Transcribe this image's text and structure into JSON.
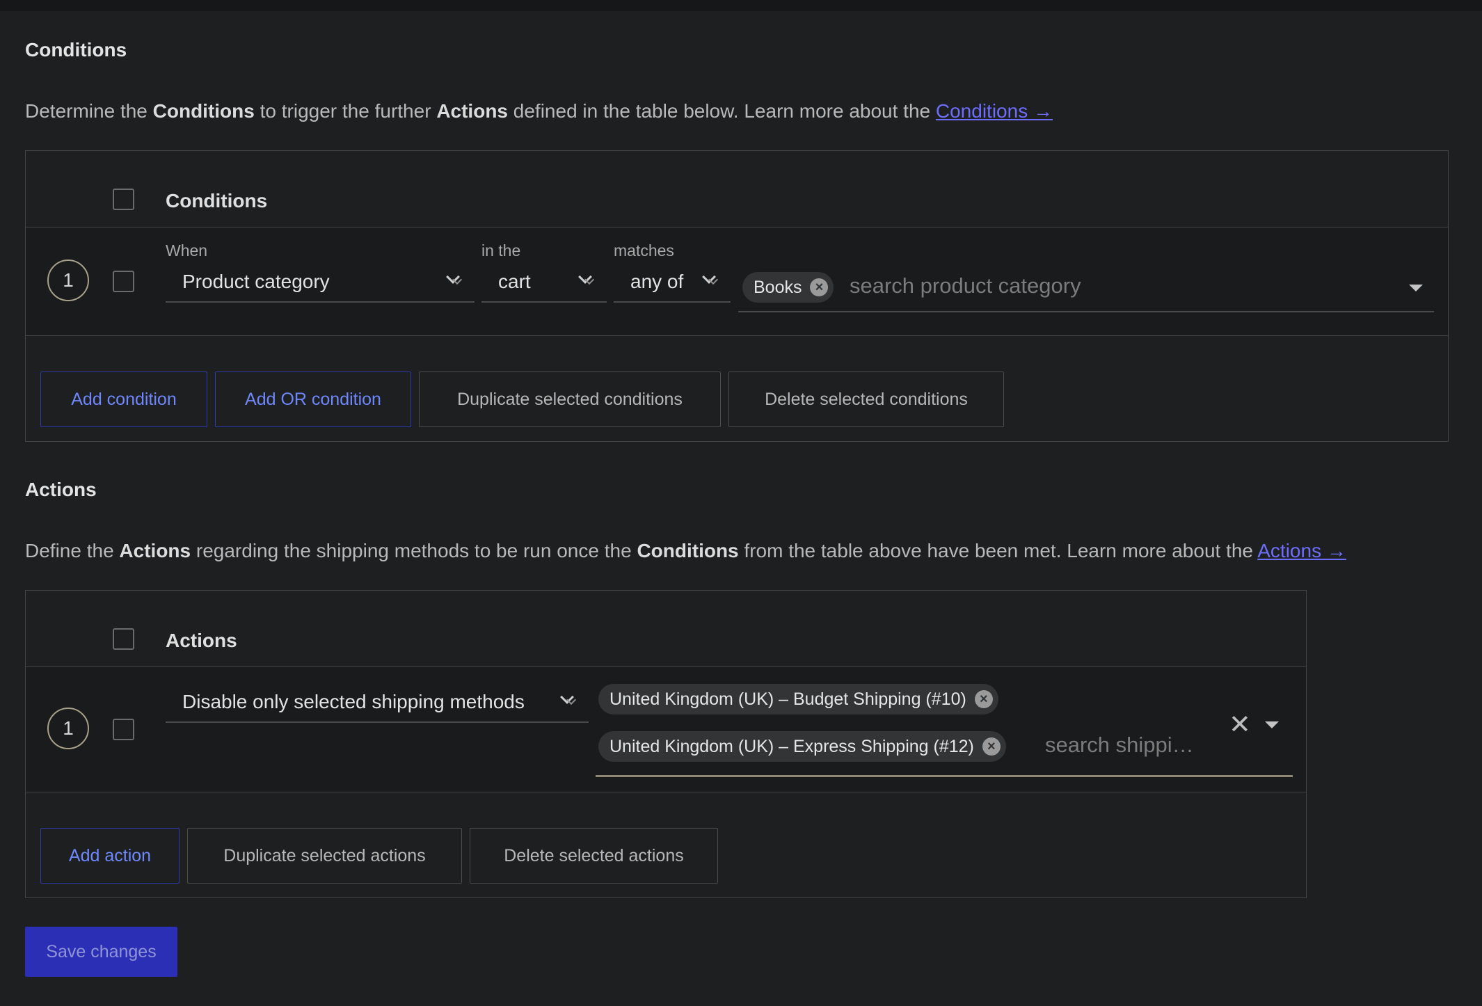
{
  "conditions_section": {
    "heading": "Conditions",
    "desc_1": "Determine the ",
    "desc_b1": "Conditions",
    "desc_2": " to trigger the further ",
    "desc_b2": "Actions",
    "desc_3": " defined in the table below. Learn more about the ",
    "desc_link": "Conditions →",
    "table_title": "Conditions",
    "row": {
      "number": "1",
      "when_label": "When",
      "when_value": "Product category",
      "in_label": "in the",
      "in_value": "cart",
      "matches_label": "matches",
      "matches_value": "any of",
      "tags": [
        "Books"
      ],
      "search_placeholder": "search product category"
    },
    "buttons": {
      "add": "Add condition",
      "add_or": "Add OR condition",
      "duplicate": "Duplicate selected conditions",
      "delete": "Delete selected conditions"
    }
  },
  "actions_section": {
    "heading": "Actions",
    "desc_1": "Define the ",
    "desc_b1": "Actions",
    "desc_2": " regarding the shipping methods to be run once the ",
    "desc_b2": "Conditions",
    "desc_3": " from the table above have been met. Learn more about the ",
    "desc_link": "Actions →",
    "table_title": "Actions",
    "row": {
      "number": "1",
      "action_value": "Disable only selected shipping methods",
      "tags": [
        "United Kingdom (UK) – Budget Shipping (#10)",
        "United Kingdom (UK) – Express Shipping (#12)"
      ],
      "search_placeholder": "search shippi…"
    },
    "buttons": {
      "add": "Add action",
      "duplicate": "Duplicate selected actions",
      "delete": "Delete selected actions"
    }
  },
  "save_button": "Save changes",
  "colors": {
    "background": "#1e1f20",
    "link": "#6d6dff",
    "primary": "#2a2fb5",
    "primary_text": "#6e87ff"
  }
}
